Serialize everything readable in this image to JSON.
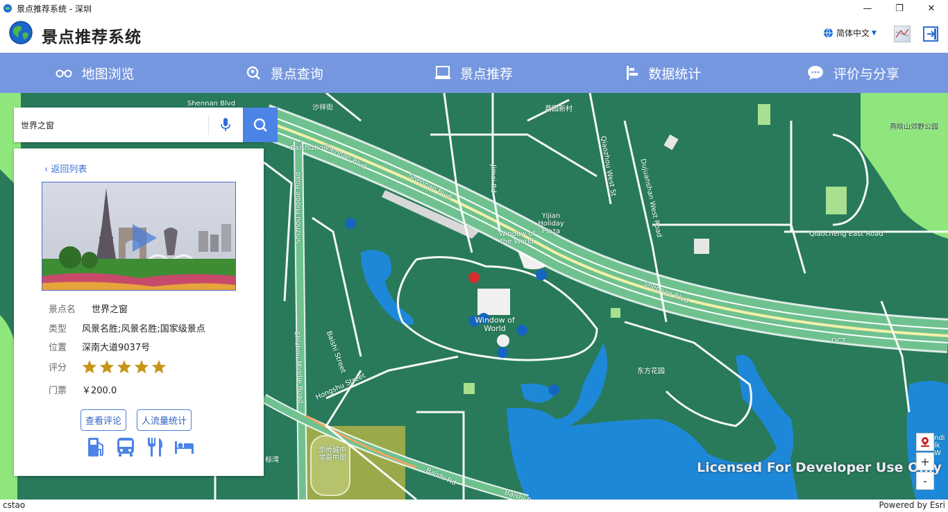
{
  "window": {
    "title": "景点推荐系统 - 深圳",
    "minimize": "—",
    "maximize": "❐",
    "close": "✕"
  },
  "header": {
    "app_title": "景点推荐系统",
    "language": "简体中文"
  },
  "nav": [
    {
      "label": "地图浏览",
      "icon": "glasses-icon"
    },
    {
      "label": "景点查询",
      "icon": "search-location-icon"
    },
    {
      "label": "景点推荐",
      "icon": "monitor-icon"
    },
    {
      "label": "数据统计",
      "icon": "bar-chart-icon"
    },
    {
      "label": "评价与分享",
      "icon": "chat-bubble-icon"
    }
  ],
  "search": {
    "value": "世界之窗"
  },
  "detail": {
    "back": "返回列表",
    "name_label": "景点名",
    "name": "世界之窗",
    "type_label": "类型",
    "type": "风景名胜;风景名胜;国家级景点",
    "location_label": "位置",
    "location": "深南大道9037号",
    "rating_label": "评分",
    "rating": 5,
    "rating_max": 5,
    "ticket_label": "门票",
    "ticket": "￥200.0",
    "btn_reviews": "查看评论",
    "btn_traffic": "人流量统计",
    "facilities": [
      "gas-station-icon",
      "bus-icon",
      "restaurant-icon",
      "hotel-icon"
    ]
  },
  "map": {
    "labels": {
      "shennan_1": "Shennan Blvd",
      "shennan_2": "Shennan Blvd",
      "shennan_3": "Shennan Blvd",
      "baishizhou": "Baishizhou",
      "shizhou_1": "Shizhou Middle Road",
      "shizhou_2": "Shizhou Middle Road",
      "jimei": "Jimei Rd",
      "qiaozhou": "Qiaozhou West St",
      "dujuanshan": "Dujuanshan West Road",
      "yijian": "Yijian Holiday Plaza",
      "wow_station": "Window of the World",
      "wow": "Window of World",
      "qiaocheng": "Qiaocheng East Road",
      "baishi_street": "Baishi Street",
      "hongshu": "Hongshu Street",
      "baishi_rd_1": "Baishi Rd",
      "baishi_rd_2": "Baishi Rd",
      "shaxiang": "沙祥街",
      "lixin": "荔园新村",
      "yanhuishan": "燕晗山郊野公园",
      "dongfang": "东方花园",
      "oct": "OCT",
      "school": "华侨城中学高中部",
      "biaowan": "标湾",
      "shenna_top": "Shennan Blvd",
      "park_edge": "ndi lk W"
    },
    "watermark": "Licensed For Developer Use Only",
    "zoom_in": "+",
    "zoom_out": "-"
  },
  "status": {
    "user": "cstao",
    "powered": "Powered by Esri"
  },
  "colors": {
    "nav": "#7597e0",
    "accent": "#4b84e6",
    "map_ground": "#287a5a",
    "water": "#1e88d8",
    "park": "#8fe67c",
    "pin_blue": "#1565c0",
    "pin_red": "#d32f2f",
    "star": "#c7941a"
  }
}
